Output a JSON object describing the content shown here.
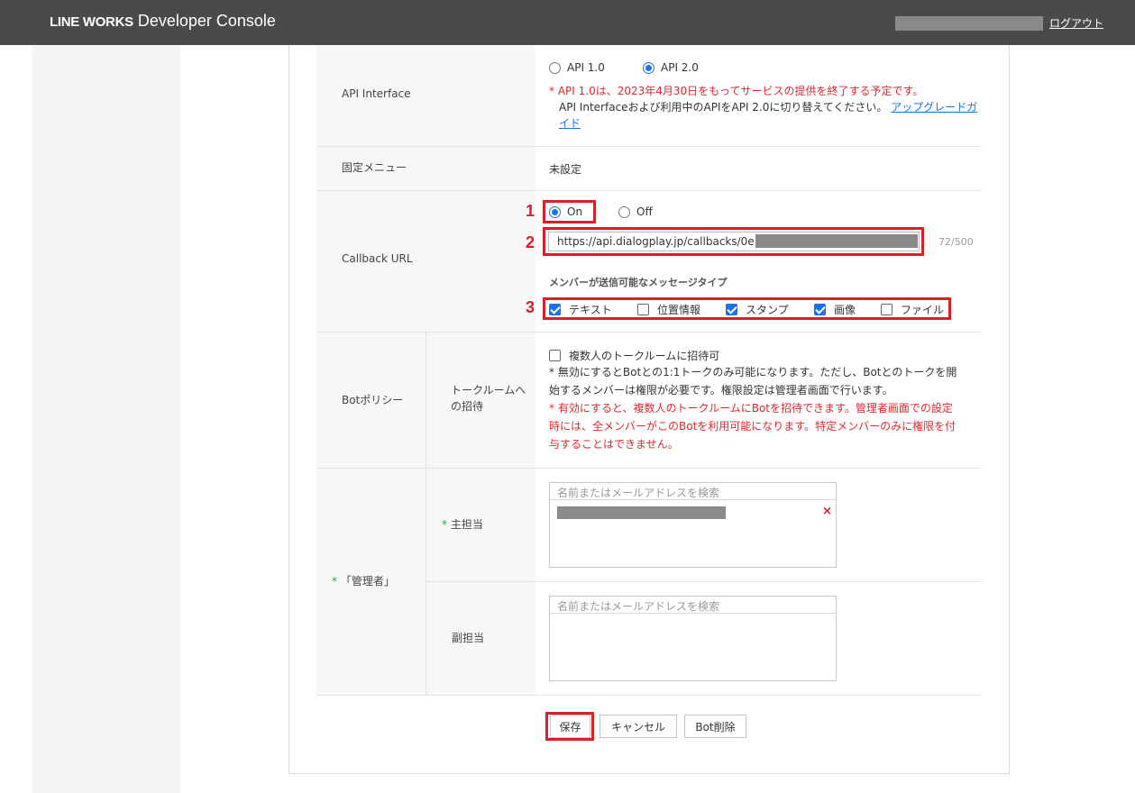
{
  "header": {
    "brand_bold": "LINE WORKS",
    "brand_light": "Developer Console",
    "logout": "ログアウト"
  },
  "api_interface": {
    "label": "API Interface",
    "options": [
      "API 1.0",
      "API 2.0"
    ],
    "selected": "API 2.0",
    "notice_red": "* API 1.0は、2023年4月30日をもってサービスの提供を終了する予定です。",
    "notice_line2": "API Interfaceおよび利用中のAPIをAPI 2.0に切り替えてください。",
    "guide_link_1": "アップグレードガ",
    "guide_link_2": "イド"
  },
  "fixed_menu": {
    "label": "固定メニュー",
    "value": "未設定"
  },
  "callback": {
    "label": "Callback URL",
    "on_label": "On",
    "off_label": "Off",
    "selected": "On",
    "url": "https://api.dialogplay.jp/callbacks/0e",
    "counter": "72/500",
    "message_types_title": "メンバーが送信可能なメッセージタイプ",
    "message_types": [
      {
        "label": "テキスト",
        "checked": true
      },
      {
        "label": "位置情報",
        "checked": false
      },
      {
        "label": "スタンプ",
        "checked": true
      },
      {
        "label": "画像",
        "checked": true
      },
      {
        "label": "ファイル",
        "checked": false
      }
    ]
  },
  "markers": [
    "1",
    "2",
    "3"
  ],
  "bot_policy": {
    "label": "Botポリシー",
    "sub_label": "トークルームへの招待",
    "checkbox_label": "複数人のトークルームに招待可",
    "note1_line1": "* 無効にするとBotとの1:1トークのみ可能になります。ただし、Botとのトークを開",
    "note1_line2": "始するメンバーは権限が必要です。権限設定は管理者画面で行います。",
    "note2_line1": "* 有効にすると、複数人のトークルームにBotを招待できます。管理者画面での設定",
    "note2_line2": "時には、全メンバーがこのBotを利用可能になります。特定メンバーのみに権限を付",
    "note2_line3": "与することはできません。"
  },
  "admin": {
    "required_mark": "*",
    "label": "「管理者」",
    "primary_label": "主担当",
    "secondary_label": "副担当",
    "search_placeholder": "名前またはメールアドレスを検索",
    "remove_icon": "×"
  },
  "buttons": {
    "save": "保存",
    "cancel": "キャンセル",
    "delete": "Bot削除"
  },
  "colors": {
    "header_bg": "#4a4a4a",
    "accent_blue": "#1a73e8",
    "annotation_red": "#d8202a",
    "required_green": "#2aa34a"
  }
}
